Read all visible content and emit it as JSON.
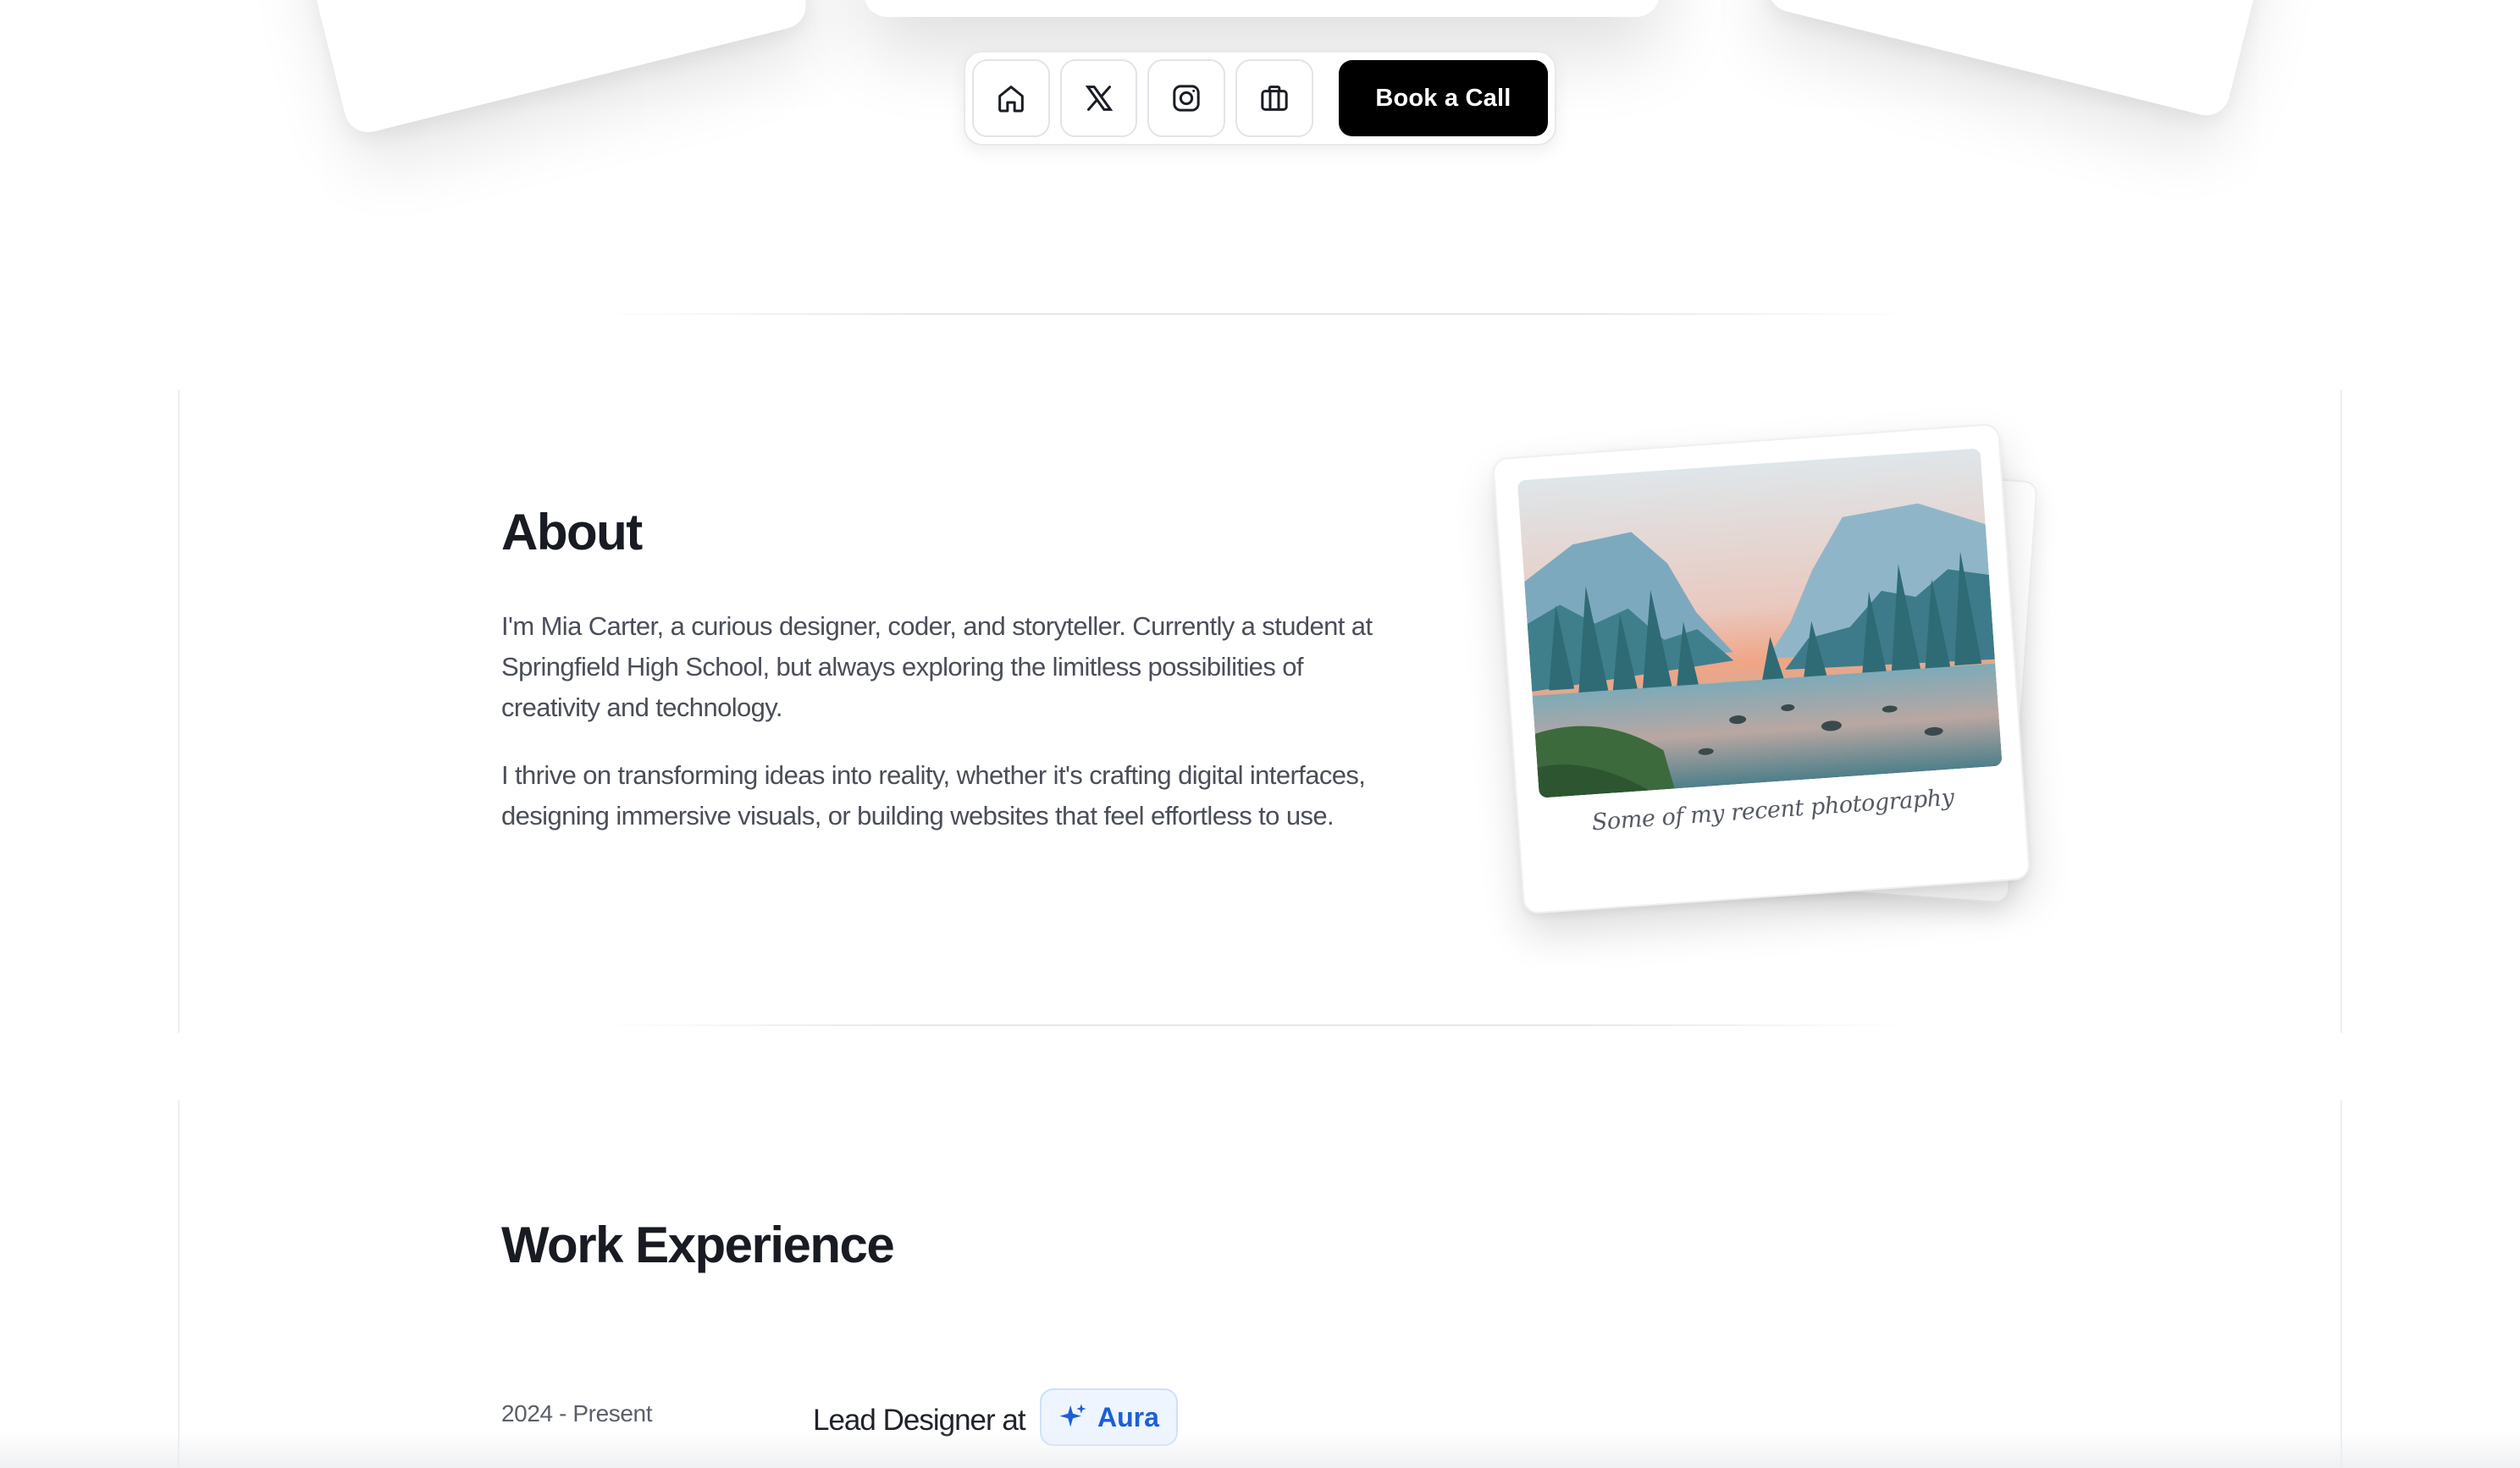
{
  "nav": {
    "items": [
      {
        "icon": "home-icon"
      },
      {
        "icon": "x-logo-icon"
      },
      {
        "icon": "instagram-icon"
      },
      {
        "icon": "briefcase-icon"
      }
    ],
    "cta_label": "Book a Call"
  },
  "about": {
    "title": "About",
    "paragraphs": [
      "I'm Mia Carter, a curious designer, coder, and storyteller. Currently a student at Springfield High School, but always exploring the limitless possibilities of creativity and technology.",
      "I thrive on transforming ideas into reality, whether it's crafting digital interfaces, designing immersive visuals, or building websites that feel effortless to use."
    ],
    "photo_caption": "Some of my recent photography"
  },
  "work": {
    "title": "Work Experience",
    "entries": [
      {
        "date": "2024 - Present",
        "role": "Lead Designer at",
        "company": "Aura",
        "company_color": "#1d5fd6"
      }
    ]
  },
  "colors": {
    "cta_bg": "#000000",
    "accent": "#1d5fd6"
  }
}
